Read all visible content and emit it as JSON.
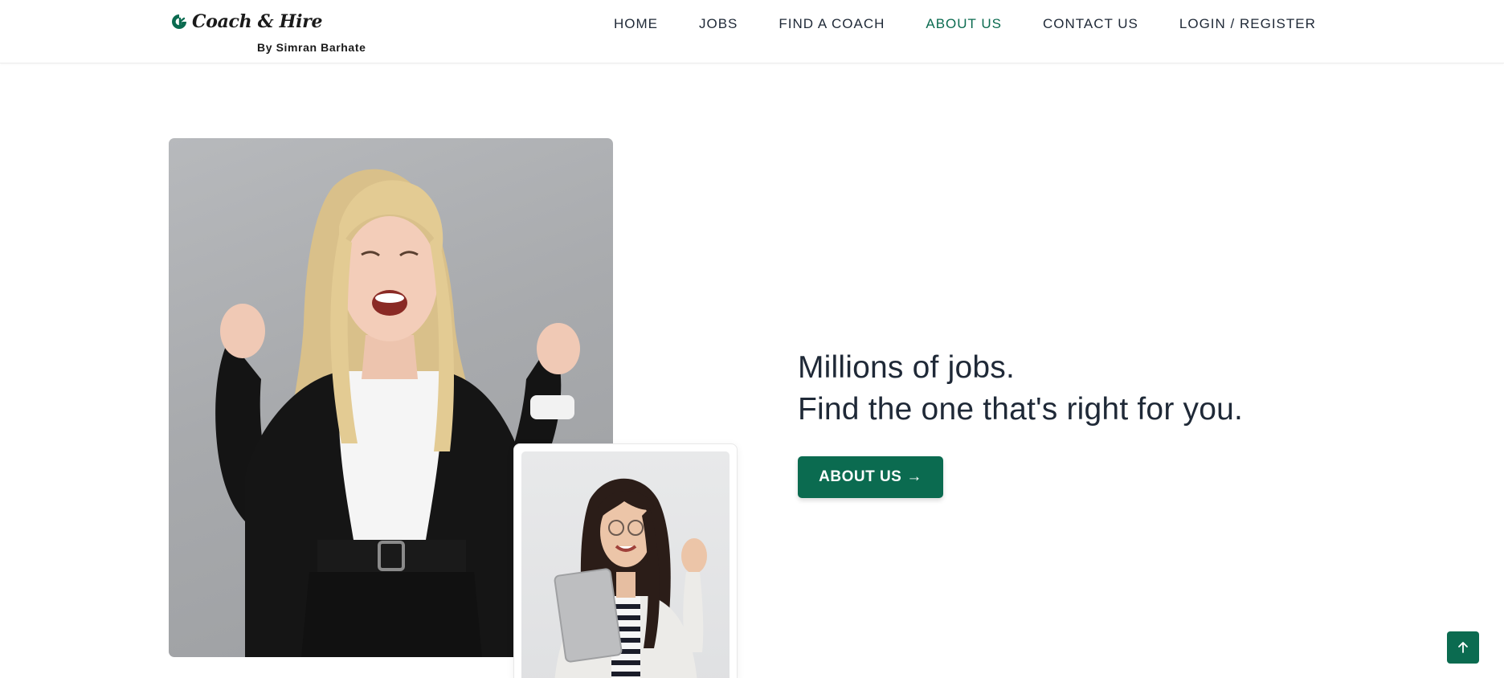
{
  "brand": {
    "name": "Coach & Hire",
    "byline": "By Simran Barhate",
    "color": "#0b6b50"
  },
  "nav": {
    "items": [
      {
        "label": "HOME",
        "active": false
      },
      {
        "label": "JOBS",
        "active": false
      },
      {
        "label": "FIND A COACH",
        "active": false
      },
      {
        "label": "ABOUT US",
        "active": true
      },
      {
        "label": "CONTACT US",
        "active": false
      },
      {
        "label": "LOGIN / REGISTER",
        "active": false
      }
    ]
  },
  "hero": {
    "title_line1": "Millions of jobs.",
    "title_line2": "Find the one that's right for you.",
    "cta_label": "ABOUT US",
    "cta_icon": "arrow-right-icon"
  },
  "main_photo": {
    "alt": "Excited woman in blazer celebrating"
  },
  "secondary_photo": {
    "alt": "Smiling woman holding laptop waving"
  },
  "scroll_top": {
    "icon": "arrow-up-icon"
  }
}
